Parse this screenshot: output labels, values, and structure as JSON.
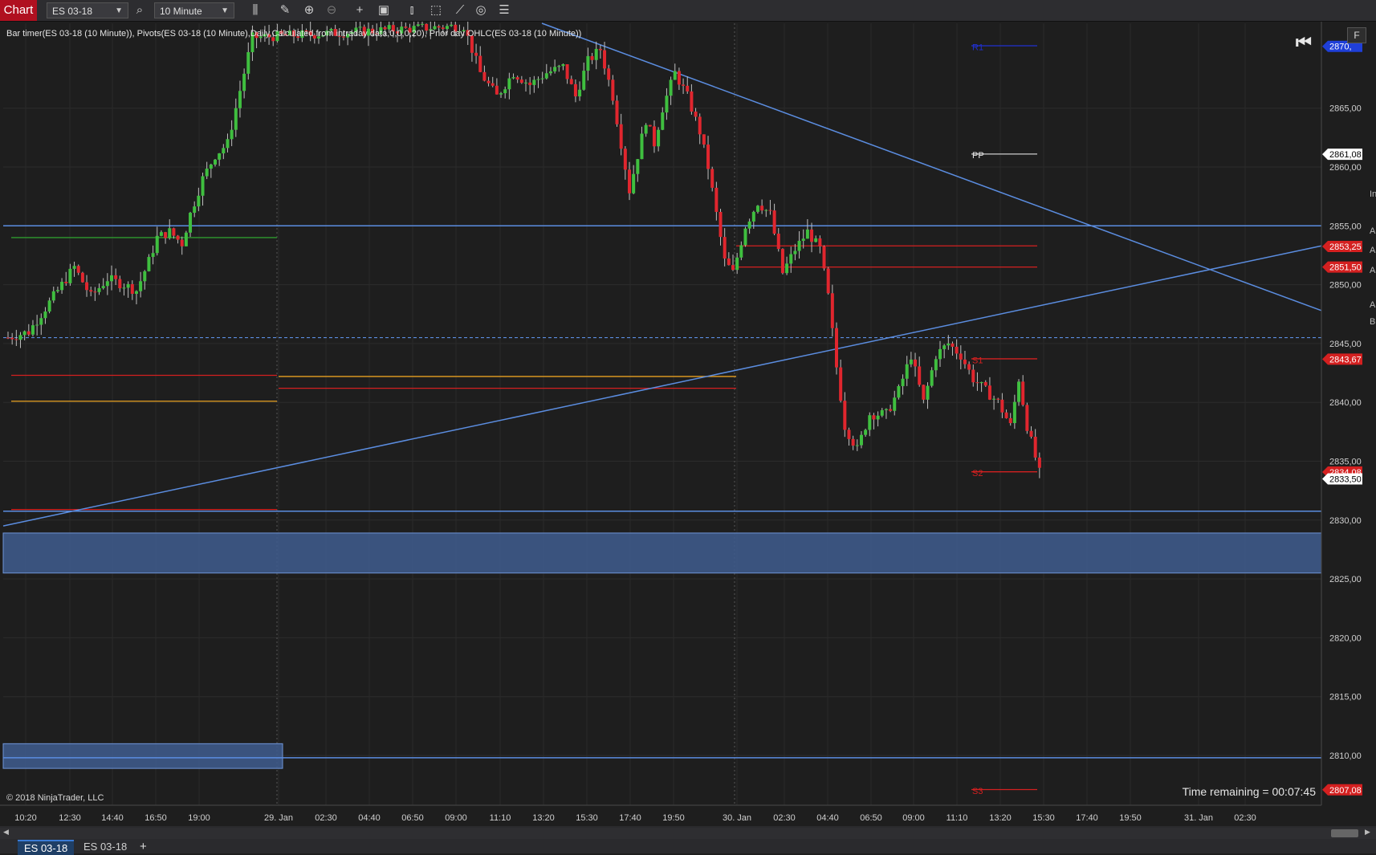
{
  "toolbar": {
    "chart_tag": "Chart",
    "instrument": "ES 03-18",
    "interval": "10 Minute",
    "icons": [
      "search-icon",
      "bar-type-icon",
      "draw-icon",
      "zoom-in-icon",
      "zoom-out-icon",
      "crosshair-icon",
      "properties-icon",
      "split-icon",
      "indicators-icon",
      "strategies-icon",
      "refresh-icon",
      "list-icon"
    ]
  },
  "indicator_text": "Bar timer(ES 03-18 (10 Minute)), Pivots(ES 03-18 (10 Minute),Daily,Calculated from intraday data,0,0,0,20), Prior day OHLC(ES 03-18 (10 Minute))",
  "copyright": "© 2018 NinjaTrader, LLC",
  "time_remaining": "Time remaining = 00:07:45",
  "f_button": "F",
  "side_fragments": [
    "In",
    "A",
    "A",
    "A",
    "A",
    "B"
  ],
  "tabs": [
    {
      "label": "ES 03-18",
      "active": true
    },
    {
      "label": "ES 03-18",
      "active": false
    }
  ],
  "add_tab": "+",
  "colors": {
    "up": "#3fbf3f",
    "down": "#e0262e",
    "trendline": "#5b8de0",
    "pivot_red": "#d42020",
    "prior_orange": "#e8a020",
    "zone_fill": "#3f5d8f",
    "background": "#1e1e1e"
  },
  "chart_data": {
    "type": "candlestick",
    "ylim": [
      2806,
      2873
    ],
    "y_ticks": [
      "2810,00",
      "2815,00",
      "2820,00",
      "2825,00",
      "2830,00",
      "2835,00",
      "2840,00",
      "2845,00",
      "2850,00",
      "2855,00",
      "2860,00",
      "2865,00"
    ],
    "y_tick_values": [
      2810,
      2815,
      2820,
      2825,
      2830,
      2835,
      2840,
      2845,
      2850,
      2855,
      2860,
      2865
    ],
    "x_ticks": [
      "10:20",
      "12:30",
      "14:40",
      "16:50",
      "19:00",
      "29. Jan",
      "02:30",
      "04:40",
      "06:50",
      "09:00",
      "11:10",
      "13:20",
      "15:30",
      "17:40",
      "19:50",
      "30. Jan",
      "02:30",
      "04:40",
      "06:50",
      "09:00",
      "11:10",
      "13:20",
      "15:30",
      "17:40",
      "19:50",
      "31. Jan",
      "02:30"
    ],
    "price_markers": [
      {
        "label": "2870,",
        "value": 2870.25,
        "color": "#1f3fd8"
      },
      {
        "label": "2861,08",
        "value": 2861.08,
        "color": "#ffffff"
      },
      {
        "label": "2853,25",
        "value": 2853.25,
        "color": "#d42020"
      },
      {
        "label": "2851,50",
        "value": 2851.5,
        "color": "#d42020"
      },
      {
        "label": "2843,67",
        "value": 2843.67,
        "color": "#d42020"
      },
      {
        "label": "2834,08",
        "value": 2834.08,
        "color": "#d42020"
      },
      {
        "label": "2833,50",
        "value": 2833.5,
        "color": "#ffffff"
      },
      {
        "label": "2807,08",
        "value": 2807.08,
        "color": "#d42020"
      }
    ],
    "pivot_labels": [
      {
        "label": "R1",
        "value": 2870.25
      },
      {
        "label": "PP",
        "value": 2861.08
      },
      {
        "label": "S1",
        "value": 2843.67
      },
      {
        "label": "S2",
        "value": 2834.08
      },
      {
        "label": "S3",
        "value": 2807.08
      }
    ],
    "horizontal_lines": [
      2855.0,
      2830.75
    ],
    "dashed_line": 2845.5,
    "zones": [
      [
        2825.5,
        2828.9
      ],
      [
        2808.9,
        2811.0
      ]
    ],
    "candle_path": [
      [
        0,
        2845.5
      ],
      [
        5,
        2846
      ],
      [
        9,
        2848
      ],
      [
        13,
        2850
      ],
      [
        16,
        2851.5
      ],
      [
        20,
        2849
      ],
      [
        24,
        2850.5
      ],
      [
        28,
        2850
      ],
      [
        31,
        2849.5
      ],
      [
        34,
        2852
      ],
      [
        36,
        2854
      ],
      [
        39,
        2854.5
      ],
      [
        42,
        2853.5
      ],
      [
        44,
        2856
      ],
      [
        47,
        2859
      ],
      [
        50,
        2861
      ],
      [
        53,
        2862
      ],
      [
        55,
        2865
      ],
      [
        57,
        2868
      ],
      [
        59,
        2871
      ],
      [
        110,
        2872
      ],
      [
        114,
        2868
      ],
      [
        118,
        2866
      ],
      [
        122,
        2868
      ],
      [
        126,
        2867
      ],
      [
        130,
        2868
      ],
      [
        134,
        2868.5
      ],
      [
        137,
        2866
      ],
      [
        140,
        2869
      ],
      [
        143,
        2870
      ],
      [
        146,
        2866
      ],
      [
        148,
        2862
      ],
      [
        150,
        2858
      ],
      [
        152,
        2861
      ],
      [
        154,
        2864
      ],
      [
        156,
        2862
      ],
      [
        158,
        2865
      ],
      [
        161,
        2868
      ],
      [
        164,
        2866
      ],
      [
        167,
        2863
      ],
      [
        169,
        2860
      ],
      [
        171,
        2856
      ],
      [
        173,
        2852
      ],
      [
        175,
        2851
      ],
      [
        178,
        2855
      ],
      [
        181,
        2857
      ],
      [
        184,
        2856
      ],
      [
        187,
        2851
      ],
      [
        190,
        2853
      ],
      [
        193,
        2854.5
      ],
      [
        196,
        2853
      ],
      [
        198,
        2849
      ],
      [
        200,
        2843
      ],
      [
        202,
        2838
      ],
      [
        205,
        2836
      ],
      [
        208,
        2839
      ],
      [
        212,
        2839
      ],
      [
        215,
        2841
      ],
      [
        218,
        2844
      ],
      [
        221,
        2840
      ],
      [
        224,
        2844
      ],
      [
        227,
        2845
      ],
      [
        230,
        2844
      ],
      [
        233,
        2842
      ],
      [
        236,
        2841
      ],
      [
        239,
        2840
      ],
      [
        242,
        2838
      ],
      [
        244,
        2842
      ],
      [
        246,
        2838
      ],
      [
        249,
        2834
      ]
    ],
    "total_slots": 314
  }
}
